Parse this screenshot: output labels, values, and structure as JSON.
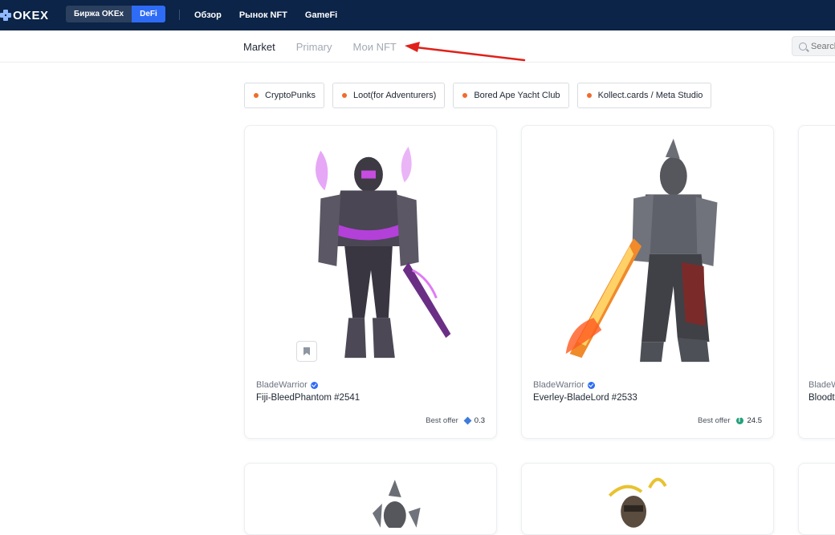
{
  "header": {
    "logo": "OKEX",
    "mode_switch": [
      "Биржа OKEx",
      "DeFi"
    ],
    "nav": [
      "Обзор",
      "Рынок NFT",
      "GameFi"
    ]
  },
  "subnav": {
    "tabs": [
      "Market",
      "Primary",
      "Мои NFT"
    ],
    "active_tab": "Market",
    "search_placeholder": "Search"
  },
  "chips": [
    "CryptoPunks",
    "Loot(for Adventurers)",
    "Bored Ape Yacht Club",
    "Kollect.cards / Meta Studio"
  ],
  "cards": [
    {
      "collection": "BladeWarrior",
      "name": "Fiji-BleedPhantom #2541",
      "offer_label": "Best offer",
      "price": "0.3",
      "currency_icon": "eth-icon"
    },
    {
      "collection": "BladeWarrior",
      "name": "Everley-BladeLord #2533",
      "offer_label": "Best offer",
      "price": "24.5",
      "currency_icon": "usdt-icon"
    },
    {
      "collection": "BladeW",
      "name": "Bloodt"
    }
  ],
  "colors": {
    "header_bg": "#0b2447",
    "accent": "#2e6cf6",
    "annotation_arrow": "#e0201a",
    "chip_dot": "#f06b2c"
  }
}
